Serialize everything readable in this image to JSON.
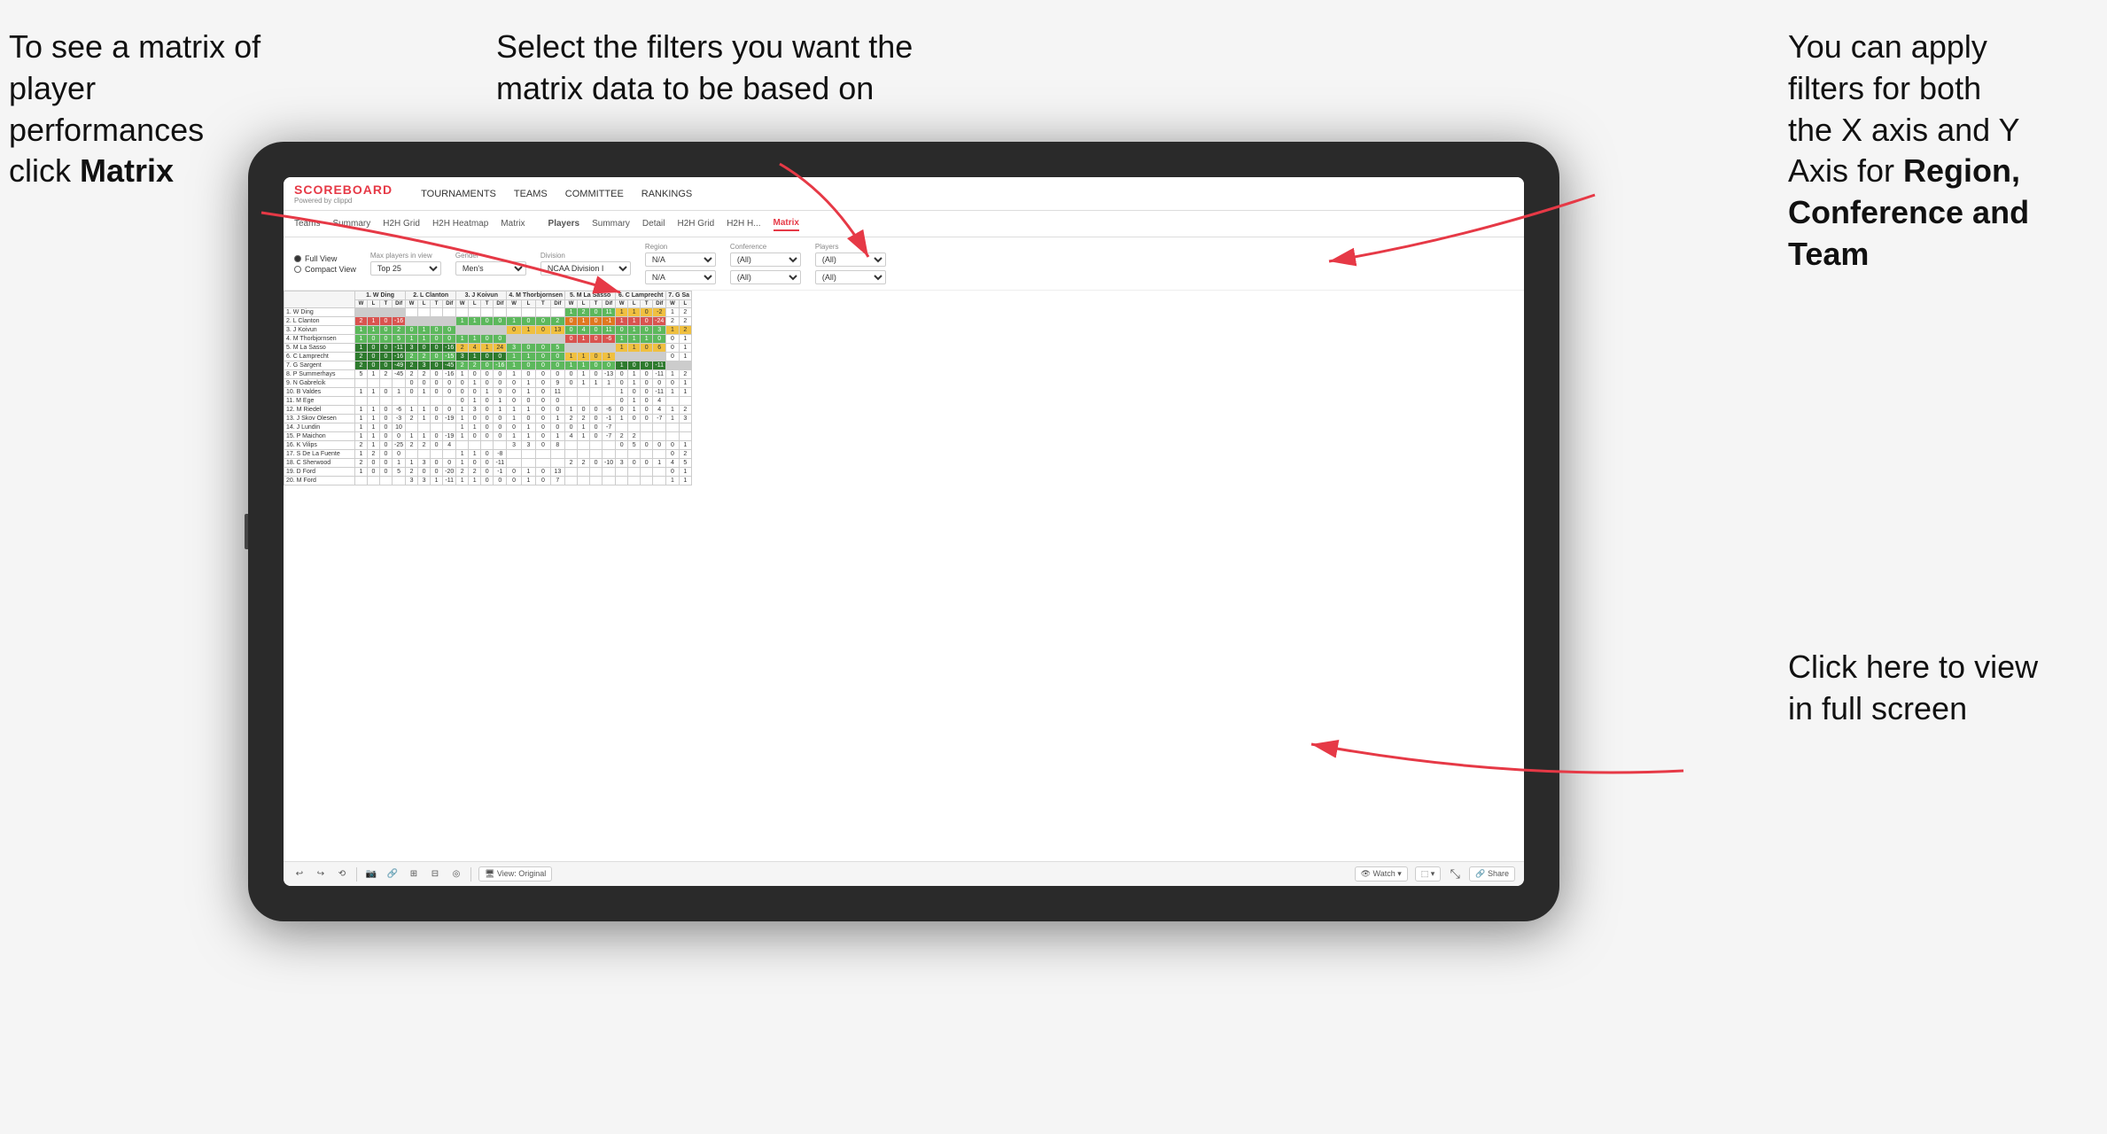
{
  "annotations": {
    "top_left": {
      "line1": "To see a matrix of",
      "line2": "player performances",
      "line3_prefix": "click ",
      "line3_bold": "Matrix"
    },
    "top_center": {
      "line1": "Select the filters you want the",
      "line2": "matrix data to be based on"
    },
    "top_right": {
      "line1": "You  can apply",
      "line2": "filters for both",
      "line3": "the X axis and Y",
      "line4_prefix": "Axis for ",
      "line4_bold": "Region,",
      "line5_bold": "Conference and",
      "line6_bold": "Team"
    },
    "bottom_right": {
      "line1": "Click here to view",
      "line2": "in full screen"
    }
  },
  "app": {
    "logo": {
      "main": "SCOREBOARD",
      "sub": "Powered by clippd"
    },
    "nav": [
      "TOURNAMENTS",
      "TEAMS",
      "COMMITTEE",
      "RANKINGS"
    ],
    "sub_nav": [
      "Teams",
      "Summary",
      "H2H Grid",
      "H2H Heatmap",
      "Matrix",
      "Players",
      "Summary",
      "Detail",
      "H2H Grid",
      "H2H H...",
      "Matrix"
    ],
    "active_tab": "Matrix"
  },
  "filters": {
    "view_options": [
      "Full View",
      "Compact View"
    ],
    "selected_view": "Full View",
    "max_players": {
      "label": "Max players in view",
      "value": "Top 25"
    },
    "gender": {
      "label": "Gender",
      "value": "Men's"
    },
    "division": {
      "label": "Division",
      "value": "NCAA Division I"
    },
    "region": {
      "label": "Region",
      "values": [
        "N/A",
        "N/A"
      ]
    },
    "conference": {
      "label": "Conference",
      "values": [
        "(All)",
        "(All)"
      ]
    },
    "players": {
      "label": "Players",
      "values": [
        "(All)",
        "(All)"
      ]
    }
  },
  "matrix": {
    "col_groups": [
      "1. W Ding",
      "2. L Clanton",
      "3. J Koivun",
      "4. M Thorbjornsen",
      "5. M La Sasso",
      "6. C Lamprecht",
      "7. G Sa"
    ],
    "sub_cols": [
      "W",
      "L",
      "T",
      "Dif"
    ],
    "rows": [
      {
        "num": "1",
        "name": "W Ding"
      },
      {
        "num": "2",
        "name": "L Clanton"
      },
      {
        "num": "3",
        "name": "J Koivun"
      },
      {
        "num": "4",
        "name": "M Thorbjornsen"
      },
      {
        "num": "5",
        "name": "M La Sasso"
      },
      {
        "num": "6",
        "name": "C Lamprecht"
      },
      {
        "num": "7",
        "name": "G Sargent"
      },
      {
        "num": "8",
        "name": "P Summerhays"
      },
      {
        "num": "9",
        "name": "N Gabrelcik"
      },
      {
        "num": "10",
        "name": "B Valdes"
      },
      {
        "num": "11",
        "name": "M Ege"
      },
      {
        "num": "12",
        "name": "M Riedel"
      },
      {
        "num": "13",
        "name": "J Skov Olesen"
      },
      {
        "num": "14",
        "name": "J Lundin"
      },
      {
        "num": "15",
        "name": "P Maichon"
      },
      {
        "num": "16",
        "name": "K Vilips"
      },
      {
        "num": "17",
        "name": "S De La Fuente"
      },
      {
        "num": "18",
        "name": "C Sherwood"
      },
      {
        "num": "19",
        "name": "D Ford"
      },
      {
        "num": "20",
        "name": "M Ford"
      }
    ]
  },
  "toolbar": {
    "left_icons": [
      "↩",
      "↪",
      "⟲",
      "⬚",
      "🔗",
      "⊞",
      "⊟",
      "◎"
    ],
    "view_label": "View: Original",
    "right_items": [
      "Watch ▾",
      "⬚ ▾",
      "⤡",
      "Share"
    ]
  }
}
